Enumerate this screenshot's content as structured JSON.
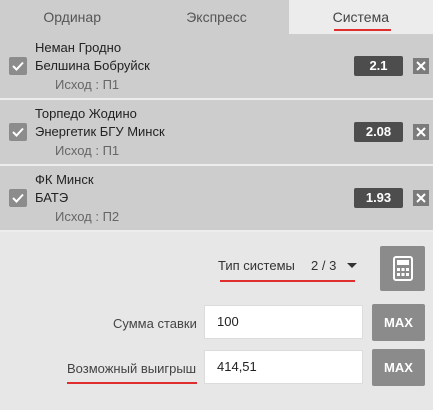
{
  "tabs": [
    {
      "label": "Ординар"
    },
    {
      "label": "Экспресс"
    },
    {
      "label": "Система"
    }
  ],
  "active_tab_index": 2,
  "bets": [
    {
      "team1": "Неман Гродно",
      "team2": "Белшина Бобруйск",
      "outcome": "Исход : П1",
      "odd": "2.1",
      "checked": true
    },
    {
      "team1": "Торпедо Жодино",
      "team2": "Энергетик БГУ Минск",
      "outcome": "Исход : П1",
      "odd": "2.08",
      "checked": true
    },
    {
      "team1": "ФК Минск",
      "team2": "БАТЭ",
      "outcome": "Исход : П2",
      "odd": "1.93",
      "checked": true
    }
  ],
  "system": {
    "label": "Тип системы",
    "value": "2 / 3"
  },
  "stake": {
    "label": "Сумма ставки",
    "value": "100",
    "max_label": "MAX"
  },
  "win": {
    "label": "Возможный выигрыш",
    "value": "414,51",
    "max_label": "MAX"
  },
  "colors": {
    "accent": "#e02d2d",
    "panel": "#cdcdcd",
    "background": "#e7e7e7",
    "odd_bg": "#4d4d4d"
  },
  "icons": {
    "checkbox": "checkmark-icon",
    "remove": "close-icon",
    "dropdown": "caret-down-icon",
    "calculator": "calculator-icon"
  }
}
